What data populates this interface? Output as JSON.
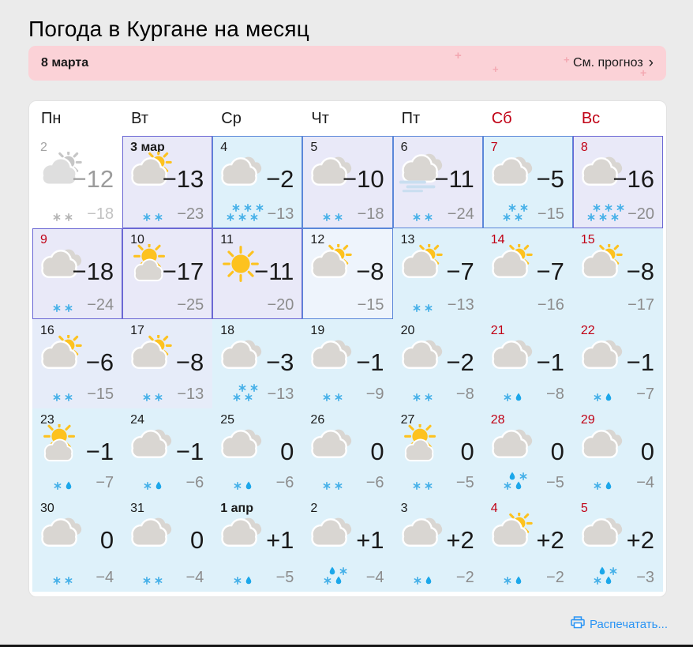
{
  "page": {
    "title": "Погода в Кургане на месяц"
  },
  "banner": {
    "label": "8 марта",
    "link_label": "См. прогноз",
    "chevron": "›",
    "sparkle_glyph": "+",
    "bg": "#fbd2d7"
  },
  "weekdays": [
    {
      "label": "Пн",
      "red": false
    },
    {
      "label": "Вт",
      "red": false
    },
    {
      "label": "Ср",
      "red": false
    },
    {
      "label": "Чт",
      "red": false
    },
    {
      "label": "Пт",
      "red": false
    },
    {
      "label": "Сб",
      "red": true
    },
    {
      "label": "Вс",
      "red": true
    }
  ],
  "colors": {
    "red_day": "#c00014",
    "snow": "#45b0e8",
    "rain": "#1ba7ea",
    "sun": "#fdc21f",
    "cloud": "#d9d6d2",
    "past_sun": "#c6c6c6",
    "past_cloud": "#dedede",
    "past_snow": "#b5b5b5",
    "fog": "#c9def0",
    "link": "#2a94f4",
    "bg_lavender": "#e9e9f8",
    "bg_cyan": "#def1fa",
    "bg_pale": "#eef4fc",
    "bg_lavlight": "#e6ecf9",
    "bg_white": "#ffffff",
    "border_blue": "#5b87d9",
    "border_purple": "#6b68d4",
    "border_none": "transparent"
  },
  "calendar": {
    "days": [
      {
        "label": "2",
        "past": true,
        "red": false,
        "month": false,
        "icon": "cloud-sun",
        "day": "−12",
        "night": "−18",
        "precip": [
          "**"
        ],
        "bg": "white",
        "border": "none"
      },
      {
        "label": "3 мар",
        "past": false,
        "red": false,
        "month": true,
        "icon": "cloud-sun",
        "day": "−13",
        "night": "−23",
        "precip": [
          "**"
        ],
        "bg": "lavender",
        "border": "purple"
      },
      {
        "label": "4",
        "past": false,
        "red": false,
        "month": false,
        "icon": "cloud",
        "day": "−2",
        "night": "−13",
        "precip": [
          "***",
          "***"
        ],
        "bg": "cyan",
        "border": "blue"
      },
      {
        "label": "5",
        "past": false,
        "red": false,
        "month": false,
        "icon": "cloud",
        "day": "−10",
        "night": "−18",
        "precip": [
          "**"
        ],
        "bg": "lavender",
        "border": "blue"
      },
      {
        "label": "6",
        "past": false,
        "red": false,
        "month": false,
        "icon": "cloud-fog",
        "day": "−11",
        "night": "−24",
        "precip": [
          "**"
        ],
        "bg": "lavender",
        "border": "blue"
      },
      {
        "label": "7",
        "past": false,
        "red": true,
        "month": false,
        "icon": "cloud",
        "day": "−5",
        "night": "−15",
        "precip": [
          "**",
          "**"
        ],
        "bg": "cyan",
        "border": "blue"
      },
      {
        "label": "8",
        "past": false,
        "red": true,
        "month": false,
        "icon": "cloud",
        "day": "−16",
        "night": "−20",
        "precip": [
          "***",
          "***"
        ],
        "bg": "lavender",
        "border": "purple"
      },
      {
        "label": "9",
        "past": false,
        "red": true,
        "month": false,
        "icon": "cloud",
        "day": "−18",
        "night": "−24",
        "precip": [
          "**"
        ],
        "bg": "lavender",
        "border": "purple"
      },
      {
        "label": "10",
        "past": false,
        "red": false,
        "month": false,
        "icon": "sun-cloud",
        "day": "−17",
        "night": "−25",
        "precip": [],
        "bg": "lavender",
        "border": "purple"
      },
      {
        "label": "11",
        "past": false,
        "red": false,
        "month": false,
        "icon": "sun",
        "day": "−11",
        "night": "−20",
        "precip": [],
        "bg": "lavender",
        "border": "purple"
      },
      {
        "label": "12",
        "past": false,
        "red": false,
        "month": false,
        "icon": "cloud-sun",
        "day": "−8",
        "night": "−15",
        "precip": [],
        "bg": "pale",
        "border": "blue"
      },
      {
        "label": "13",
        "past": false,
        "red": false,
        "month": false,
        "icon": "cloud-sun",
        "day": "−7",
        "night": "−13",
        "precip": [
          "**"
        ],
        "bg": "cyan",
        "border": "none"
      },
      {
        "label": "14",
        "past": false,
        "red": true,
        "month": false,
        "icon": "cloud-sun",
        "day": "−7",
        "night": "−16",
        "precip": [],
        "bg": "cyan",
        "border": "none"
      },
      {
        "label": "15",
        "past": false,
        "red": true,
        "month": false,
        "icon": "cloud-sun",
        "day": "−8",
        "night": "−17",
        "precip": [],
        "bg": "cyan",
        "border": "none"
      },
      {
        "label": "16",
        "past": false,
        "red": false,
        "month": false,
        "icon": "cloud-sun",
        "day": "−6",
        "night": "−15",
        "precip": [
          "**"
        ],
        "bg": "lavlight",
        "border": "none"
      },
      {
        "label": "17",
        "past": false,
        "red": false,
        "month": false,
        "icon": "cloud-sun",
        "day": "−8",
        "night": "−13",
        "precip": [
          "**"
        ],
        "bg": "lavlight",
        "border": "none"
      },
      {
        "label": "18",
        "past": false,
        "red": false,
        "month": false,
        "icon": "cloud",
        "day": "−3",
        "night": "−13",
        "precip": [
          "**",
          "**"
        ],
        "bg": "cyan",
        "border": "none"
      },
      {
        "label": "19",
        "past": false,
        "red": false,
        "month": false,
        "icon": "cloud",
        "day": "−1",
        "night": "−9",
        "precip": [
          "**"
        ],
        "bg": "cyan",
        "border": "none"
      },
      {
        "label": "20",
        "past": false,
        "red": false,
        "month": false,
        "icon": "cloud",
        "day": "−2",
        "night": "−8",
        "precip": [
          "**"
        ],
        "bg": "cyan",
        "border": "none"
      },
      {
        "label": "21",
        "past": false,
        "red": true,
        "month": false,
        "icon": "cloud",
        "day": "−1",
        "night": "−8",
        "precip": [
          "*d"
        ],
        "bg": "cyan",
        "border": "none"
      },
      {
        "label": "22",
        "past": false,
        "red": true,
        "month": false,
        "icon": "cloud",
        "day": "−1",
        "night": "−7",
        "precip": [
          "*d"
        ],
        "bg": "cyan",
        "border": "none"
      },
      {
        "label": "23",
        "past": false,
        "red": false,
        "month": false,
        "icon": "sun-cloud",
        "day": "−1",
        "night": "−7",
        "precip": [
          "*d"
        ],
        "bg": "cyan",
        "border": "none"
      },
      {
        "label": "24",
        "past": false,
        "red": false,
        "month": false,
        "icon": "cloud",
        "day": "−1",
        "night": "−6",
        "precip": [
          "*d"
        ],
        "bg": "cyan",
        "border": "none"
      },
      {
        "label": "25",
        "past": false,
        "red": false,
        "month": false,
        "icon": "cloud",
        "day": "0",
        "night": "−6",
        "precip": [
          "*d"
        ],
        "bg": "cyan",
        "border": "none"
      },
      {
        "label": "26",
        "past": false,
        "red": false,
        "month": false,
        "icon": "cloud",
        "day": "0",
        "night": "−6",
        "precip": [
          "**"
        ],
        "bg": "cyan",
        "border": "none"
      },
      {
        "label": "27",
        "past": false,
        "red": false,
        "month": false,
        "icon": "sun-cloud",
        "day": "0",
        "night": "−5",
        "precip": [
          "**"
        ],
        "bg": "cyan",
        "border": "none"
      },
      {
        "label": "28",
        "past": false,
        "red": true,
        "month": false,
        "icon": "cloud",
        "day": "0",
        "night": "−5",
        "precip": [
          "d*",
          "*d"
        ],
        "bg": "cyan",
        "border": "none"
      },
      {
        "label": "29",
        "past": false,
        "red": true,
        "month": false,
        "icon": "cloud",
        "day": "0",
        "night": "−4",
        "precip": [
          "*d"
        ],
        "bg": "cyan",
        "border": "none"
      },
      {
        "label": "30",
        "past": false,
        "red": false,
        "month": false,
        "icon": "cloud",
        "day": "0",
        "night": "−4",
        "precip": [
          "**"
        ],
        "bg": "cyan",
        "border": "none"
      },
      {
        "label": "31",
        "past": false,
        "red": false,
        "month": false,
        "icon": "cloud",
        "day": "0",
        "night": "−4",
        "precip": [
          "**"
        ],
        "bg": "cyan",
        "border": "none"
      },
      {
        "label": "1 апр",
        "past": false,
        "red": false,
        "month": true,
        "icon": "cloud",
        "day": "+1",
        "night": "−5",
        "precip": [
          "*d"
        ],
        "bg": "cyan",
        "border": "none"
      },
      {
        "label": "2",
        "past": false,
        "red": false,
        "month": false,
        "icon": "cloud",
        "day": "+1",
        "night": "−4",
        "precip": [
          "d*",
          "*d"
        ],
        "bg": "cyan",
        "border": "none"
      },
      {
        "label": "3",
        "past": false,
        "red": false,
        "month": false,
        "icon": "cloud",
        "day": "+2",
        "night": "−2",
        "precip": [
          "*d"
        ],
        "bg": "cyan",
        "border": "none"
      },
      {
        "label": "4",
        "past": false,
        "red": true,
        "month": false,
        "icon": "cloud-sun",
        "day": "+2",
        "night": "−2",
        "precip": [
          "*d"
        ],
        "bg": "cyan",
        "border": "none"
      },
      {
        "label": "5",
        "past": false,
        "red": true,
        "month": false,
        "icon": "cloud",
        "day": "+2",
        "night": "−3",
        "precip": [
          "d*",
          "*d"
        ],
        "bg": "cyan",
        "border": "none"
      }
    ]
  },
  "footer": {
    "print_label": "Распечатать..."
  }
}
